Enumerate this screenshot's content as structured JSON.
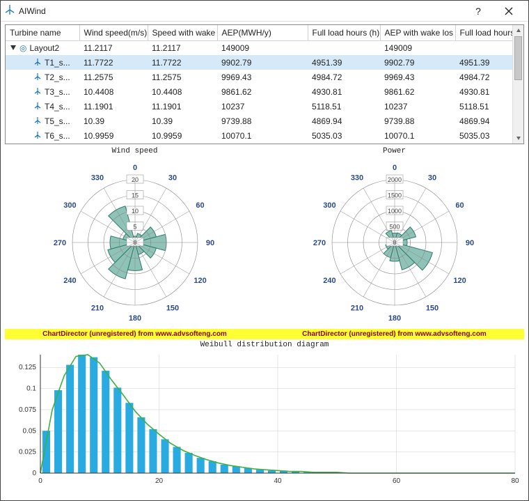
{
  "app": {
    "title": "AIWind"
  },
  "table": {
    "columns": [
      "Turbine name",
      "Wind speed(m/s)",
      "Speed with wake l",
      "AEP(MWH/y)",
      "Full load hours (h)",
      "AEP with wake los",
      "Full load hours wi"
    ],
    "layout_label": "Layout2",
    "layout_row": [
      "11.2117",
      "11.2117",
      "149009",
      "",
      "149009",
      ""
    ],
    "rows": [
      {
        "name": "T1_s...",
        "cells": [
          "11.7722",
          "11.7722",
          "9902.79",
          "4951.39",
          "9902.79",
          "4951.39"
        ],
        "selected": true
      },
      {
        "name": "T2_s...",
        "cells": [
          "11.2575",
          "11.2575",
          "9969.43",
          "4984.72",
          "9969.43",
          "4984.72"
        ],
        "selected": false
      },
      {
        "name": "T3_s...",
        "cells": [
          "10.4408",
          "10.4408",
          "9861.62",
          "4930.81",
          "9861.62",
          "4930.81"
        ],
        "selected": false
      },
      {
        "name": "T4_s...",
        "cells": [
          "11.1901",
          "11.1901",
          "10237",
          "5118.51",
          "10237",
          "5118.51"
        ],
        "selected": false
      },
      {
        "name": "T5_s...",
        "cells": [
          "10.39",
          "10.39",
          "9739.88",
          "4869.94",
          "9739.88",
          "4869.94"
        ],
        "selected": false
      },
      {
        "name": "T6_s...",
        "cells": [
          "10.9959",
          "10.9959",
          "10070.1",
          "5035.03",
          "10070.1",
          "5035.03"
        ],
        "selected": false
      }
    ]
  },
  "polar_windspeed": {
    "title": "Wind speed",
    "radial_ticks": [
      0,
      5,
      10,
      15,
      20
    ],
    "radial_tick_labels": [
      "0",
      "5",
      "10",
      "15",
      "20"
    ],
    "angle_labels": [
      "0",
      "30",
      "60",
      "90",
      "120",
      "150",
      "180",
      "210",
      "240",
      "270",
      "300",
      "330"
    ]
  },
  "polar_power": {
    "title": "Power",
    "radial_ticks": [
      0,
      500,
      1000,
      1500,
      2000
    ],
    "radial_tick_labels": [
      "0",
      "500",
      "1000",
      "1500",
      "2000"
    ],
    "angle_labels": [
      "0",
      "30",
      "60",
      "90",
      "120",
      "150",
      "180",
      "210",
      "240",
      "270",
      "300",
      "330"
    ]
  },
  "watermark_text": "ChartDirector (unregistered) from www.advsofteng.com",
  "weibull": {
    "title": "Weibull distribution diagram",
    "y_ticks": [
      "0",
      "0.025",
      "0.05",
      "0.075",
      "0.1",
      "0.125"
    ],
    "x_ticks": [
      "0",
      "20",
      "40",
      "60",
      "80"
    ],
    "x_max": 80
  },
  "colors": {
    "polar_fill": "#7db9ac",
    "polar_stroke": "#2e7a6b",
    "bar": "#29abe2",
    "line": "#3cb043"
  },
  "chart_data": [
    {
      "type": "polar-bar",
      "title": "Wind speed",
      "id": "windspeed_rose",
      "angle_deg": [
        0,
        30,
        60,
        90,
        120,
        150,
        180,
        210,
        240,
        270,
        300,
        330
      ],
      "values": [
        2,
        3,
        7,
        10,
        7,
        4,
        9,
        12,
        9,
        8,
        4,
        12
      ],
      "radial_range": [
        0,
        20
      ],
      "angle_labels": [
        "0",
        "30",
        "60",
        "90",
        "120",
        "150",
        "180",
        "210",
        "240",
        "270",
        "300",
        "330"
      ]
    },
    {
      "type": "polar-bar",
      "title": "Power",
      "id": "power_rose",
      "angle_deg": [
        0,
        30,
        60,
        90,
        120,
        150,
        180,
        210,
        240,
        270,
        300,
        330
      ],
      "values": [
        300,
        320,
        700,
        400,
        1250,
        900,
        600,
        500,
        300,
        200,
        200,
        400
      ],
      "radial_range": [
        0,
        2000
      ],
      "angle_labels": [
        "0",
        "30",
        "60",
        "90",
        "120",
        "150",
        "180",
        "210",
        "240",
        "270",
        "300",
        "330"
      ]
    },
    {
      "type": "bar",
      "title": "Weibull distribution diagram",
      "id": "weibull_hist",
      "x": [
        1,
        3,
        5,
        7,
        9,
        11,
        13,
        15,
        17,
        19,
        21,
        23,
        25,
        27,
        29,
        31,
        33,
        35,
        37,
        39,
        41,
        43,
        45,
        47,
        49,
        51
      ],
      "y": [
        0.05,
        0.098,
        0.128,
        0.14,
        0.137,
        0.121,
        0.101,
        0.083,
        0.066,
        0.052,
        0.04,
        0.031,
        0.024,
        0.018,
        0.014,
        0.01,
        0.008,
        0.006,
        0.004,
        0.003,
        0.003,
        0.002,
        0.001,
        0.001,
        0.001,
        0.0
      ],
      "xlabel": "",
      "ylabel": "",
      "ylim": [
        0,
        0.14
      ],
      "xlim": [
        0,
        80
      ],
      "overlay_line": {
        "x": [
          0,
          2,
          4,
          6,
          8,
          10,
          12,
          14,
          16,
          18,
          20,
          22,
          24,
          26,
          28,
          30,
          32,
          34,
          36,
          38,
          40,
          42,
          44,
          46,
          48,
          50,
          52,
          80
        ],
        "y": [
          0.0,
          0.075,
          0.115,
          0.138,
          0.14,
          0.13,
          0.11,
          0.092,
          0.073,
          0.058,
          0.046,
          0.035,
          0.027,
          0.021,
          0.016,
          0.012,
          0.009,
          0.007,
          0.005,
          0.004,
          0.003,
          0.002,
          0.002,
          0.001,
          0.001,
          0.001,
          0.0,
          0.0
        ]
      }
    }
  ]
}
